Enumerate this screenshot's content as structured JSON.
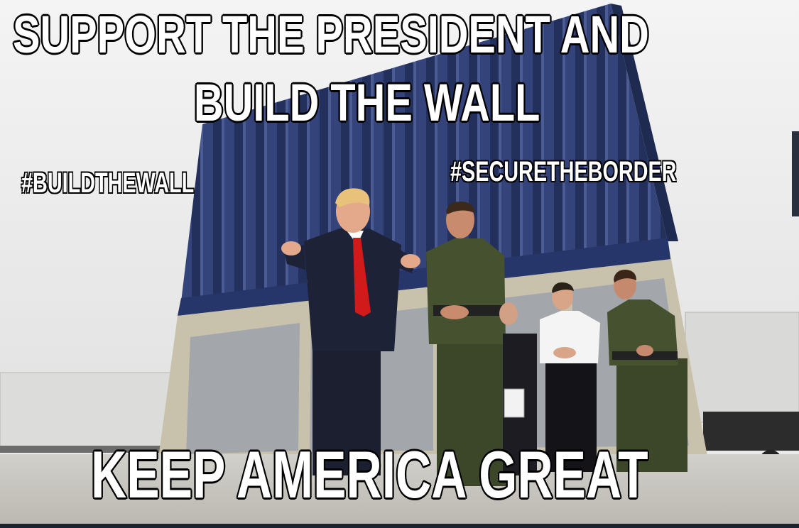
{
  "meme": {
    "top_line_1": "SUPPORT THE PRESIDENT AND",
    "top_line_2": "BUILD THE WALL",
    "hashtag_left": "#BUILDTHEWALL",
    "hashtag_right": "#SECURETHEBORDER",
    "bottom_line": "KEEP AMERICA GREAT"
  },
  "scene": {
    "description_icons": [
      "border-wall-prototype",
      "speaker-in-suit",
      "border-patrol-agents",
      "trailers"
    ],
    "colors": {
      "sky": "#ececec",
      "wall_panel": "#2f3f6e",
      "wall_base": "#c9c3ae",
      "ground": "#c7c5bf",
      "uniform": "#3f4a2c",
      "suit": "#1e2236",
      "tie": "#d11a1a"
    }
  }
}
